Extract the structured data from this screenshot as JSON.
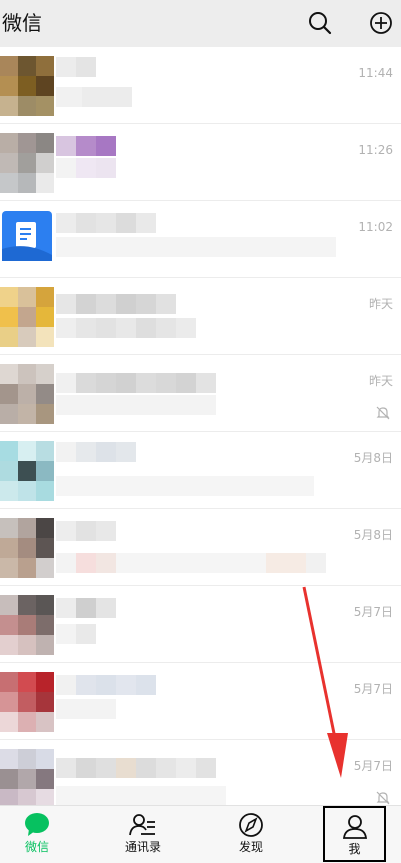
{
  "header": {
    "title": "微信",
    "search_icon": "search-icon",
    "add_icon": "plus-circle-icon"
  },
  "chats": [
    {
      "time": "11:44",
      "muted": false
    },
    {
      "time": "11:26",
      "muted": false
    },
    {
      "time": "11:02",
      "muted": false
    },
    {
      "time": "昨天",
      "muted": false
    },
    {
      "time": "昨天",
      "muted": true
    },
    {
      "time": "5月8日",
      "muted": false
    },
    {
      "time": "5月8日",
      "muted": false
    },
    {
      "time": "5月7日",
      "muted": false
    },
    {
      "time": "5月7日",
      "muted": false
    },
    {
      "time": "5月7日",
      "muted": true
    }
  ],
  "tabbar": {
    "items": [
      {
        "label": "微信",
        "icon": "chat-bubble-icon",
        "active": true
      },
      {
        "label": "通讯录",
        "icon": "contacts-icon",
        "active": false
      },
      {
        "label": "发现",
        "icon": "compass-icon",
        "active": false
      },
      {
        "label": "我",
        "icon": "person-icon",
        "active": false
      }
    ]
  },
  "colors": {
    "accent": "#07c160",
    "header_bg": "#ededed",
    "tabbar_bg": "#f7f7f7",
    "arrow": "#e8322e",
    "time_text": "#b2b2b2"
  }
}
